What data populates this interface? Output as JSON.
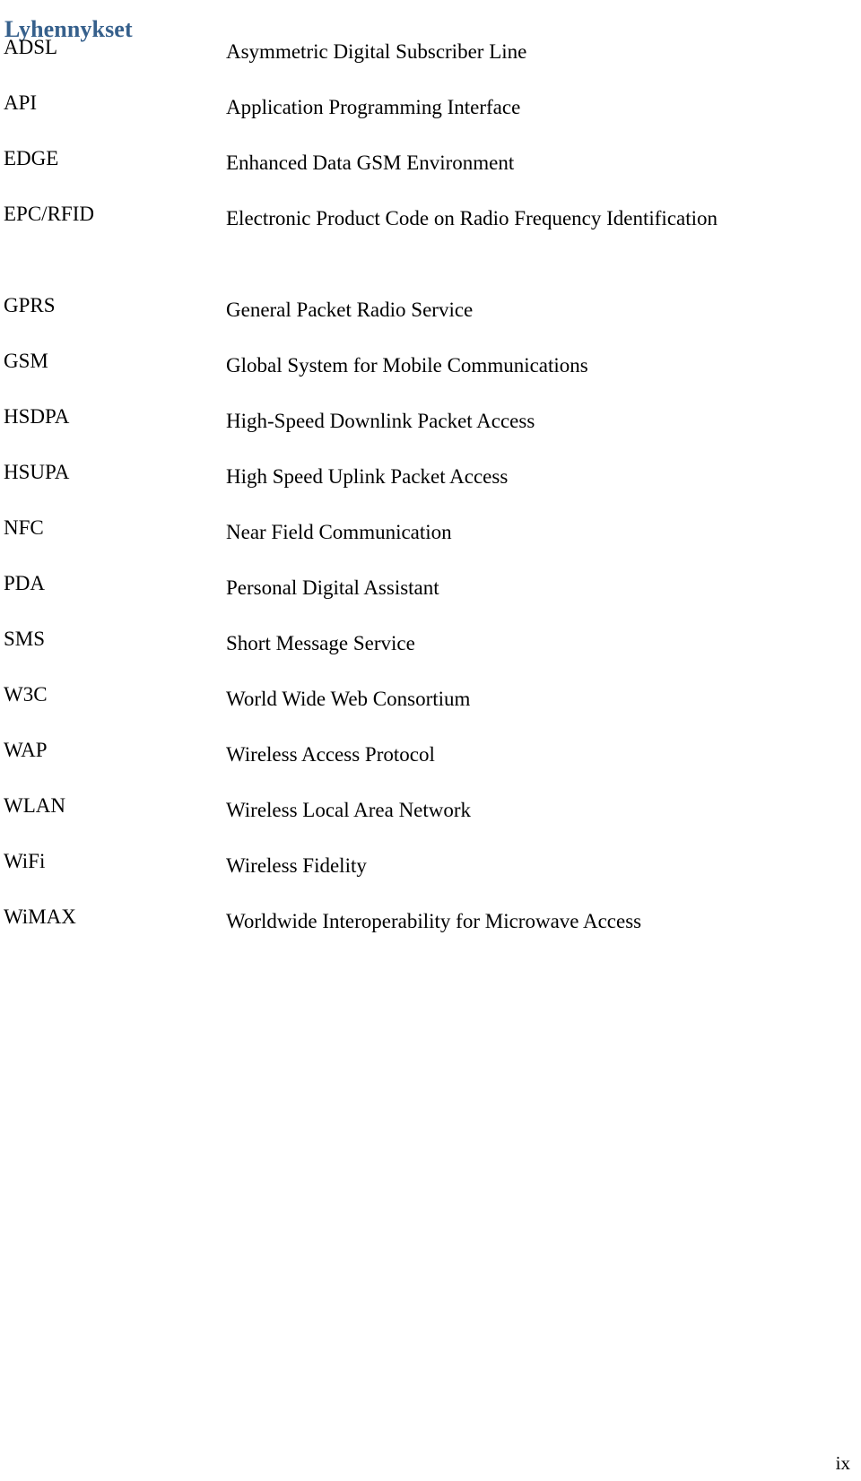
{
  "page": {
    "title": "Lyhennykset",
    "title_color": "#36608C",
    "body_color": "#000000",
    "background_color": "#FFFFFF",
    "folio": "ix"
  },
  "glossary": {
    "entries": [
      {
        "abbr": "ADSL",
        "definition": "Asymmetric Digital Subscriber Line",
        "justified": false
      },
      {
        "abbr": "API",
        "definition": "Application Programming Interface",
        "justified": false
      },
      {
        "abbr": "EDGE",
        "definition": "Enhanced Data GSM Environment",
        "justified": false
      },
      {
        "abbr": "EPC/RFID",
        "definition": "Electronic Product Code on Radio Frequency Identification",
        "justified": true
      },
      {
        "abbr": "GPRS",
        "definition": "General Packet Radio Service",
        "justified": false
      },
      {
        "abbr": "GSM",
        "definition": "Global System for Mobile Communications",
        "justified": false
      },
      {
        "abbr": "HSDPA",
        "definition": "High-Speed Downlink Packet Access",
        "justified": false
      },
      {
        "abbr": "HSUPA",
        "definition": "High Speed Uplink Packet Access",
        "justified": false
      },
      {
        "abbr": "NFC",
        "definition": "Near Field Communication",
        "justified": false
      },
      {
        "abbr": "PDA",
        "definition": "Personal Digital Assistant",
        "justified": false
      },
      {
        "abbr": "SMS",
        "definition": "Short Message Service",
        "justified": false
      },
      {
        "abbr": "W3C",
        "definition": "World Wide Web Consortium",
        "justified": false
      },
      {
        "abbr": "WAP",
        "definition": "Wireless Access Protocol",
        "justified": false
      },
      {
        "abbr": "WLAN",
        "definition": "Wireless Local Area Network",
        "justified": false
      },
      {
        "abbr": "WiFi",
        "definition": "Wireless Fidelity",
        "justified": false
      },
      {
        "abbr": "WiMAX",
        "definition": "Worldwide Interoperability for Microwave Access",
        "justified": false
      }
    ]
  }
}
